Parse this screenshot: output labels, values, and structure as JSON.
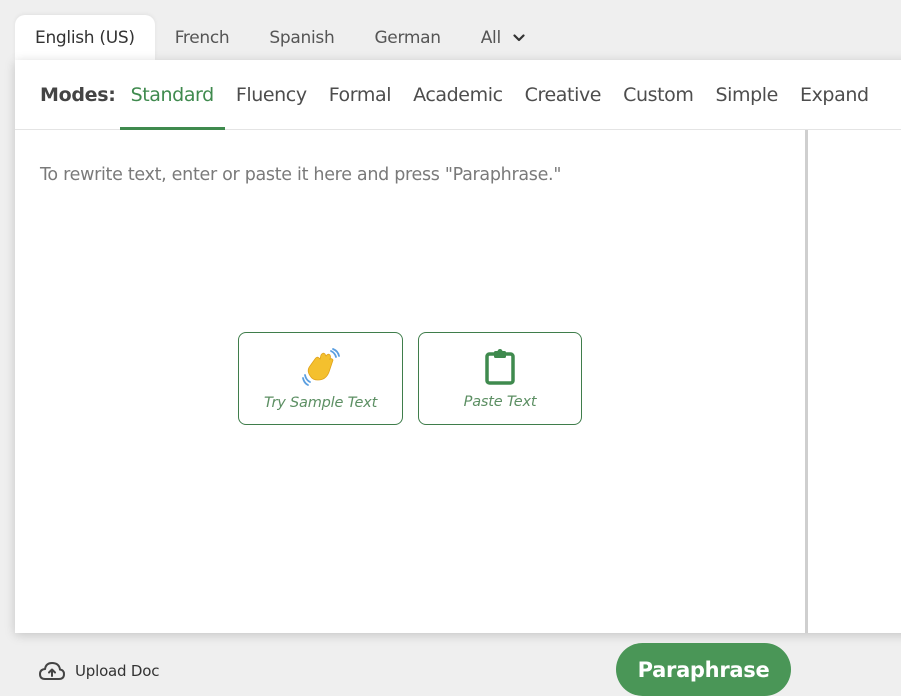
{
  "language_tabs": [
    {
      "label": "English (US)",
      "active": true
    },
    {
      "label": "French"
    },
    {
      "label": "Spanish"
    },
    {
      "label": "German"
    },
    {
      "label": "All",
      "has_dropdown": true
    }
  ],
  "modes": {
    "label": "Modes:",
    "items": [
      "Standard",
      "Fluency",
      "Formal",
      "Academic",
      "Creative",
      "Custom",
      "Simple",
      "Expand"
    ],
    "active": "Standard"
  },
  "editor": {
    "placeholder": "To rewrite text, enter or paste it here and press \"Paraphrase.\"",
    "try_sample_label": "Try Sample Text",
    "try_sample_icon": "waving-hand-icon",
    "paste_label": "Paste Text",
    "paste_icon": "clipboard-icon"
  },
  "footer": {
    "upload_label": "Upload Doc",
    "upload_icon": "cloud-upload-icon",
    "paraphrase_label": "Paraphrase"
  },
  "colors": {
    "accent": "#3f8a4e",
    "button": "#4a9657"
  }
}
